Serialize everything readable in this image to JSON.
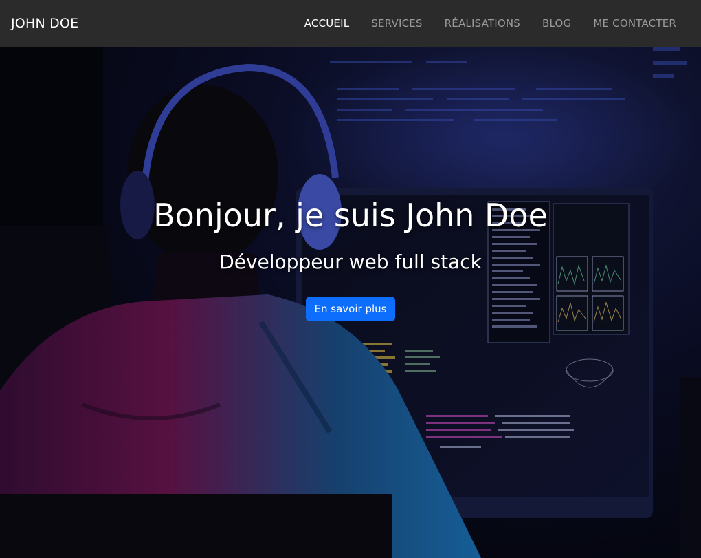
{
  "navbar": {
    "brand": "JOHN DOE",
    "items": [
      {
        "label": "ACCUEIL",
        "active": true
      },
      {
        "label": "SERVICES",
        "active": false
      },
      {
        "label": "RÉALISATIONS",
        "active": false
      },
      {
        "label": "BLOG",
        "active": false
      },
      {
        "label": "ME CONTACTER",
        "active": false
      }
    ]
  },
  "hero": {
    "title": "Bonjour, je suis John Doe",
    "subtitle": "Développeur web full stack",
    "button_label": "En savoir plus",
    "background_icon": "developer-at-computer-photo"
  },
  "colors": {
    "navbar_bg": "#2b2b2b",
    "accent": "#0d6efd",
    "nav_inactive": "#9a9a9a",
    "nav_active": "#ffffff"
  }
}
